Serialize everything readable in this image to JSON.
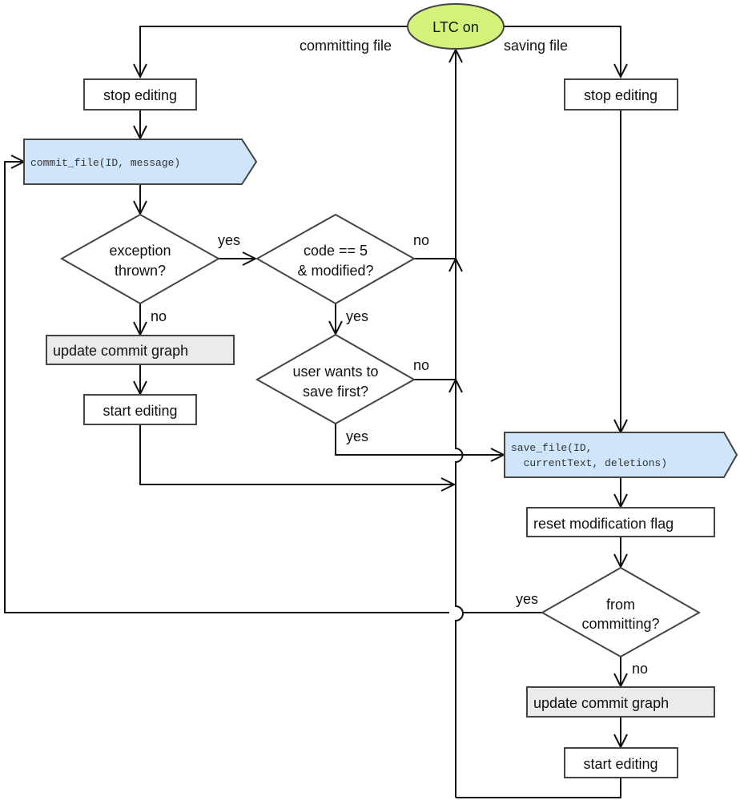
{
  "diagram": {
    "title_node": {
      "label": "LTC on",
      "fill": "#d4f27a"
    },
    "branch_labels": {
      "left": "committing file",
      "right": "saving file"
    },
    "nodes": {
      "stop_editing_left": "stop editing",
      "commit_file": "commit_file(ID, message)",
      "exception_thrown": [
        "exception",
        "thrown?"
      ],
      "code_modified": [
        "code == 5",
        "& modified?"
      ],
      "update_graph_left": "update commit graph",
      "user_save_first": [
        "user wants to",
        "save first?"
      ],
      "start_editing_left": "start editing",
      "stop_editing_right": "stop editing",
      "save_file": [
        "save_file(ID,",
        "  currentText, deletions)"
      ],
      "reset_flag": "reset modification flag",
      "from_committing": [
        "from",
        "committing?"
      ],
      "update_graph_right": "update commit graph",
      "start_editing_right": "start editing"
    },
    "edge_labels": {
      "exception_yes": "yes",
      "exception_no": "no",
      "code_no": "no",
      "code_yes": "yes",
      "user_no": "no",
      "user_yes": "yes",
      "from_yes": "yes",
      "from_no": "no"
    },
    "colors": {
      "function_fill": "#cfe5fb",
      "highlight_fill": "#ebebeb",
      "start_fill": "#d4f27a"
    }
  }
}
